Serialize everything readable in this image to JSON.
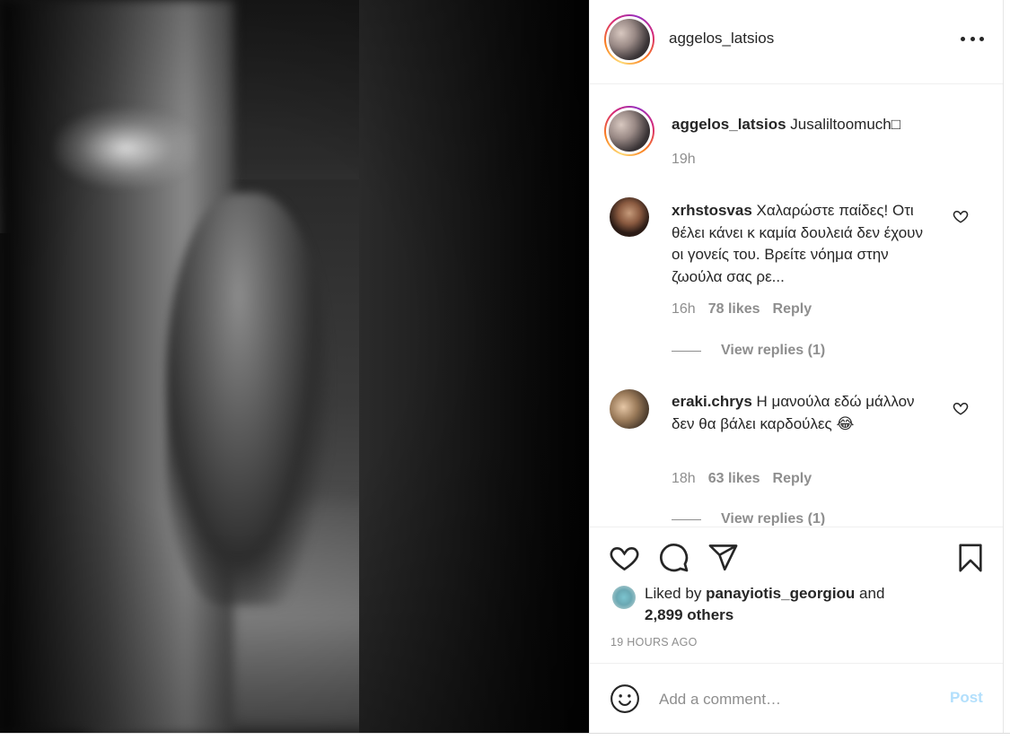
{
  "post": {
    "author": "aggelos_latsios",
    "more_icon": "more-horizontal-icon"
  },
  "caption": {
    "username": "aggelos_latsios",
    "text": "Jusaliltoomuch□",
    "time": "19h"
  },
  "comments": [
    {
      "username": "xrhstosvas",
      "text": "Χαλαρώστε παίδες! Οτι θέλει κάνει κ καμία δουλειά δεν έχουν οι γονείς του. Βρείτε νόημα στην ζωούλα σας ρε...",
      "time": "16h",
      "likes": "78 likes",
      "reply_label": "Reply",
      "view_replies": "View replies (1)"
    },
    {
      "username": "eraki.chrys",
      "text": "Η μανούλα εδώ μάλλον δεν θα βάλει καρδούλες 😂",
      "time": "18h",
      "likes": "63 likes",
      "reply_label": "Reply",
      "view_replies": "View replies (1)"
    }
  ],
  "actions": {
    "like_icon": "heart-icon",
    "comment_icon": "comment-bubble-icon",
    "share_icon": "paper-plane-icon",
    "save_icon": "bookmark-icon"
  },
  "likes": {
    "prefix": "Liked by",
    "user": "panayiotis_georgiou",
    "and": "and",
    "others": "2,899 others"
  },
  "timestamp": "19 HOURS AGO",
  "add_comment": {
    "placeholder": "Add a comment…",
    "post_label": "Post",
    "emoji_icon": "smiley-icon"
  },
  "colors": {
    "text": "#262626",
    "muted": "#8e8e8e",
    "post_disabled": "#b2dffc",
    "divider": "#efefef"
  }
}
